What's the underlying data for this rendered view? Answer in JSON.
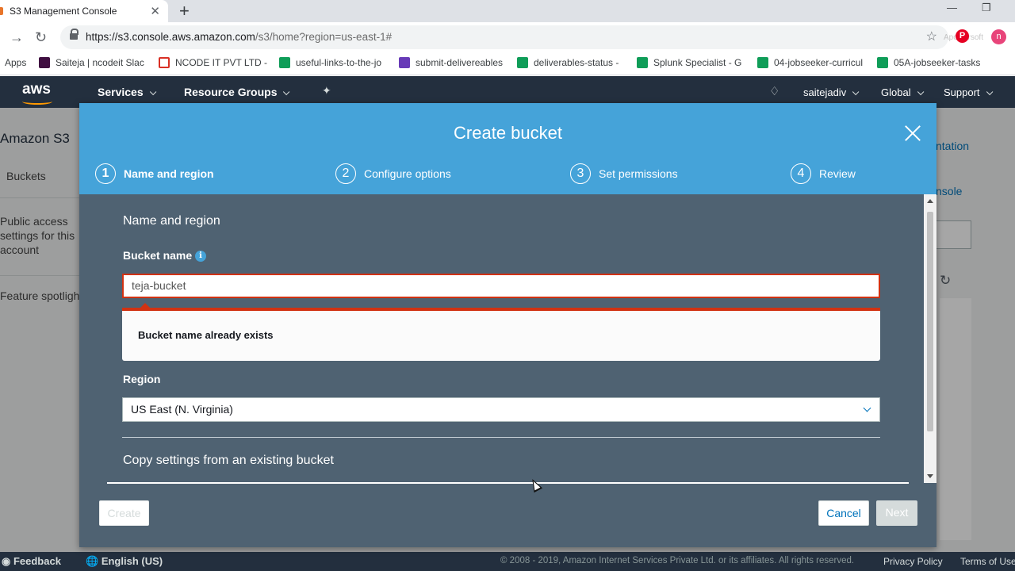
{
  "browser": {
    "tab_title": "S3 Management Console",
    "tab_close": "✕",
    "new_tab": "+",
    "url_host": "https://s3.console.aws.amazon.com",
    "url_path": "/s3/home?region=us-east-1#",
    "watermark": "Apowersoft",
    "profile_initial": "n",
    "bookmarks": [
      {
        "label": "Apps",
        "icon": "apps-grid-icon"
      },
      {
        "label": "Saiteja | ncodeit Slac",
        "icon": "slack-icon"
      },
      {
        "label": "NCODE IT PVT LTD -",
        "icon": "red-favicon-icon"
      },
      {
        "label": "useful-links-to-the-jo",
        "icon": "sheets-icon"
      },
      {
        "label": "submit-delivereables",
        "icon": "forms-icon"
      },
      {
        "label": "deliverables-status -",
        "icon": "sheets-icon"
      },
      {
        "label": "Splunk Specialist - G",
        "icon": "sheets-icon"
      },
      {
        "label": "04-jobseeker-curricul",
        "icon": "sheets-icon"
      },
      {
        "label": "05A-jobseeker-tasks",
        "icon": "sheets-icon"
      }
    ]
  },
  "aws_nav": {
    "logo": "aws",
    "services": "Services",
    "resource_groups": "Resource Groups",
    "user": "saitejadiv",
    "region": "Global",
    "support": "Support"
  },
  "background": {
    "title": "Amazon S3",
    "sidebar": [
      "Buckets",
      "Public access settings for this account",
      "Feature spotlight"
    ],
    "right_link_1": "ntation",
    "right_link_2": "nsole"
  },
  "modal": {
    "title": "Create bucket",
    "steps": [
      {
        "num": "1",
        "label": "Name and region",
        "active": true
      },
      {
        "num": "2",
        "label": "Configure options",
        "active": false
      },
      {
        "num": "3",
        "label": "Set permissions",
        "active": false
      },
      {
        "num": "4",
        "label": "Review",
        "active": false
      }
    ],
    "section_title": "Name and region",
    "bucket_name_label": "Bucket name",
    "bucket_name_value": "teja-bucket",
    "error_text": "Bucket name already exists",
    "region_label": "Region",
    "region_value": "US East (N. Virginia)",
    "copy_settings_title": "Copy settings from an existing bucket",
    "buttons": {
      "create": "Create",
      "cancel": "Cancel",
      "next": "Next"
    }
  },
  "footer": {
    "feedback": "Feedback",
    "language": "English (US)",
    "copyright": "© 2008 - 2019, Amazon Internet Services Private Ltd. or its affiliates. All rights reserved.",
    "privacy": "Privacy Policy",
    "terms": "Terms of Use"
  },
  "colors": {
    "modal_header": "#45a3d9",
    "modal_body": "#4f6272",
    "error_red": "#d13212",
    "aws_nav": "#232f3e",
    "link_blue": "#0073bb"
  }
}
